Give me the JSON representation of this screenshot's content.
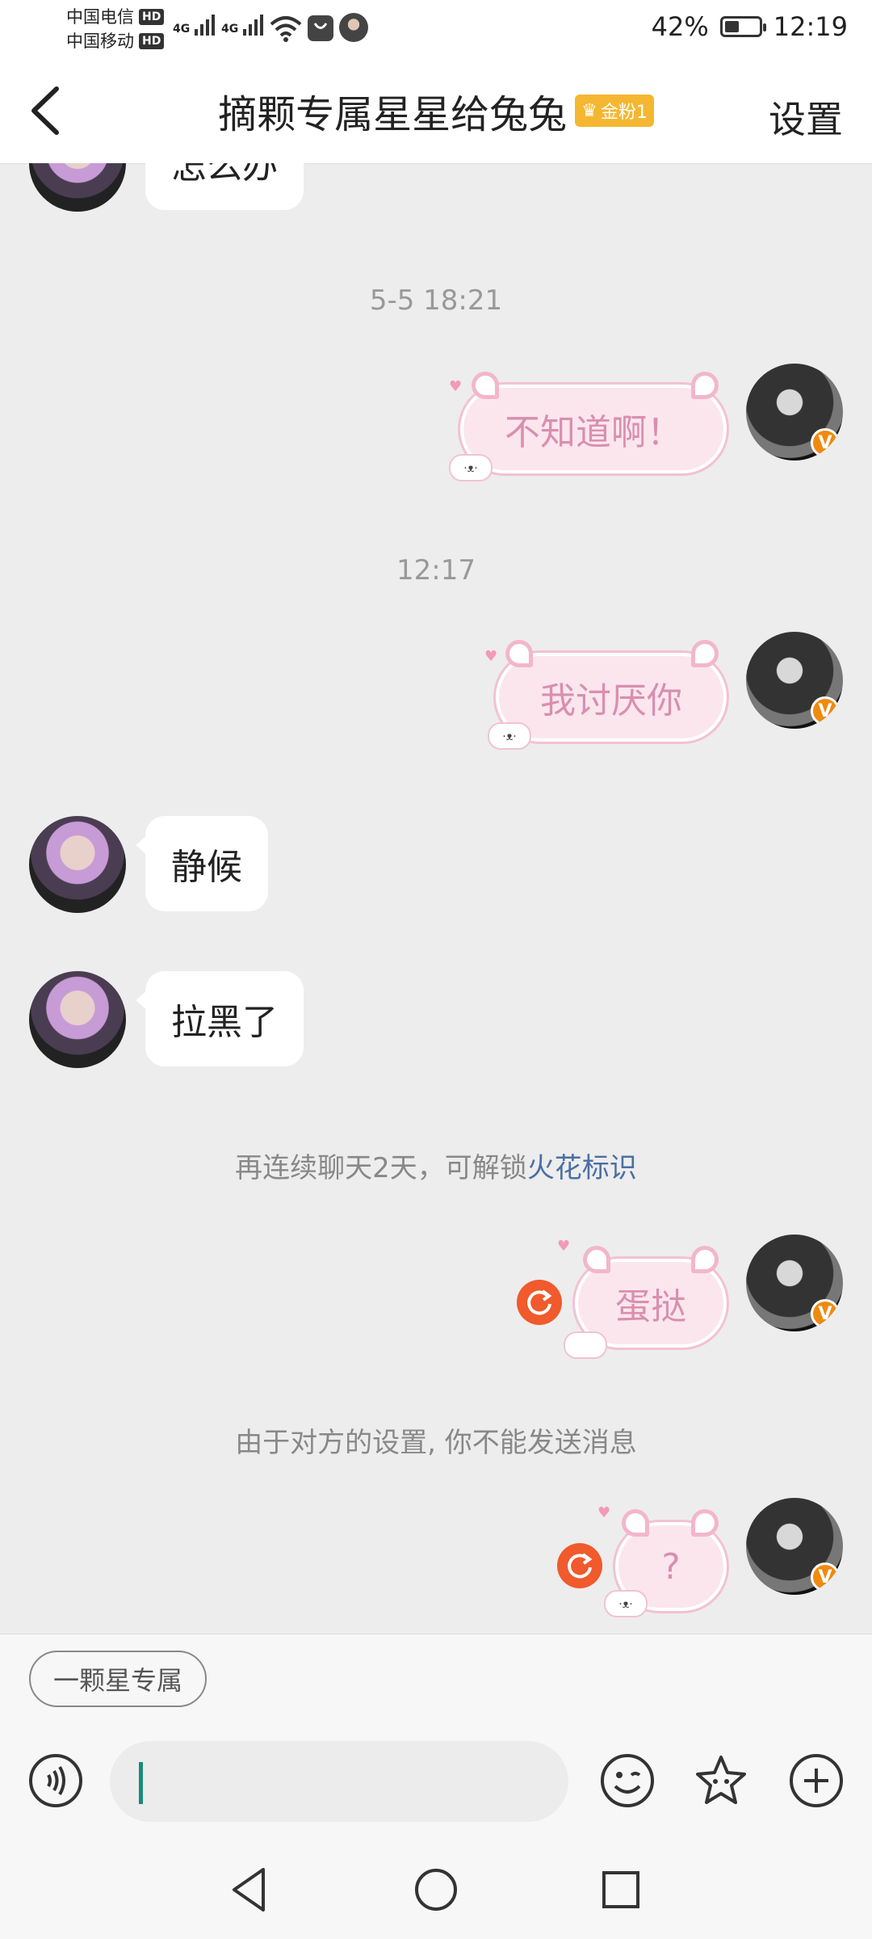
{
  "status_bar": {
    "carrier1": "中国电信",
    "carrier2": "中国移动",
    "hd_label": "HD",
    "network1": "4G",
    "network2": "4G",
    "battery_percent": "42%",
    "battery_level": 0.42,
    "time": "12:19"
  },
  "header": {
    "back_icon": "chevron-left-icon",
    "title": "摘颗专属星星给兔兔",
    "fan_badge": "金粉1",
    "settings_label": "设置"
  },
  "chat": {
    "partial_message": "怎么办",
    "timestamps": [
      "5-5 18:21",
      "12:17"
    ],
    "messages": [
      {
        "side": "right",
        "text": "不知道啊！"
      },
      {
        "side": "right",
        "text": "我讨厌你"
      },
      {
        "side": "left",
        "text": "静候"
      },
      {
        "side": "left",
        "text": "拉黑了"
      },
      {
        "side": "right",
        "text": "蛋挞",
        "failed": true
      },
      {
        "side": "right",
        "text": "?",
        "failed": true
      }
    ],
    "streak_note_prefix": "再连续聊天2天，可解锁",
    "streak_note_link": "火花标识",
    "blocked_note": "由于对方的设置, 你不能发送消息",
    "verified_badge": "V"
  },
  "input": {
    "quick_reply": "一颗星专属",
    "text_value": "",
    "icons": [
      "voice-icon",
      "emoji-icon",
      "star-sticker-icon",
      "plus-icon"
    ]
  },
  "nav": {
    "icons": [
      "back-triangle-icon",
      "home-circle-icon",
      "recents-square-icon"
    ]
  },
  "colors": {
    "accent_orange": "#f08a0f",
    "resend_red": "#f05a2c",
    "link_blue": "#4a6fa5",
    "bubble_pink_text": "#d98fae",
    "chat_bg": "#ededed"
  }
}
